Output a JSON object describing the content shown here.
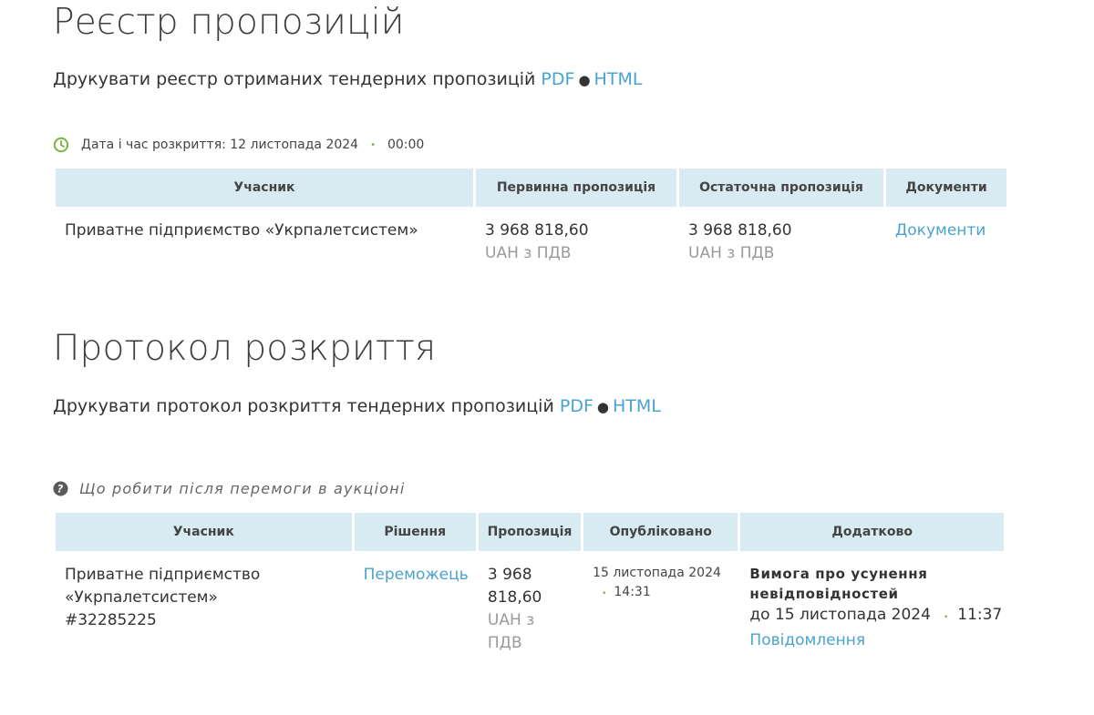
{
  "registry": {
    "title": "Реєстр пропозицій",
    "print_text": "Друкувати реєстр отриманих тендерних пропозицій",
    "pdf_label": "PDF",
    "sep": "●",
    "html_label": "HTML",
    "opening_label": "Дата і час розкриття: 12 листопада 2024",
    "opening_dot": "•",
    "opening_time": "00:00",
    "columns": [
      "Учасник",
      "Первинна пропозиція",
      "Остаточна пропозиція",
      "Документи"
    ],
    "rows": [
      {
        "participant": "Приватне підприємство «Укрпалетсистем»",
        "initial_amount": "3 968 818,60",
        "initial_currency": "UAH з ПДВ",
        "final_amount": "3 968 818,60",
        "final_currency": "UAH з ПДВ",
        "documents_link": "Документи"
      }
    ]
  },
  "protocol": {
    "title": "Протокол розкриття",
    "print_text": "Друкувати протокол розкриття тендерних пропозицій",
    "pdf_label": "PDF",
    "sep": "●",
    "html_label": "HTML",
    "help_text": "Що робити після перемоги в аукціоні",
    "columns": [
      "Учасник",
      "Рішення",
      "Пропозиція",
      "Опубліковано",
      "Додатково"
    ],
    "rows": [
      {
        "participant_line1": "Приватне підприємство",
        "participant_line2": "«Укрпалетсистем»",
        "participant_id": "#32285225",
        "decision": "Переможець",
        "amount_line1": "3 968",
        "amount_line2": "818,60",
        "currency_line1": "UAH з",
        "currency_line2": "ПДВ",
        "published_date": "15 листопада 2024",
        "published_dot": "•",
        "published_time": "14:31",
        "extra_title_line1": "Вимога про усунення",
        "extra_title_line2": "невідповідностей",
        "extra_deadline_date": "до 15 листопада 2024",
        "extra_deadline_dot": "•",
        "extra_deadline_time": "11:37",
        "extra_link": "Повідомлення"
      }
    ]
  },
  "colors": {
    "link": "#4aa3cf",
    "header_bg": "#d8ebf2",
    "accent_green": "#7cb342",
    "muted": "#9a9a9a"
  }
}
